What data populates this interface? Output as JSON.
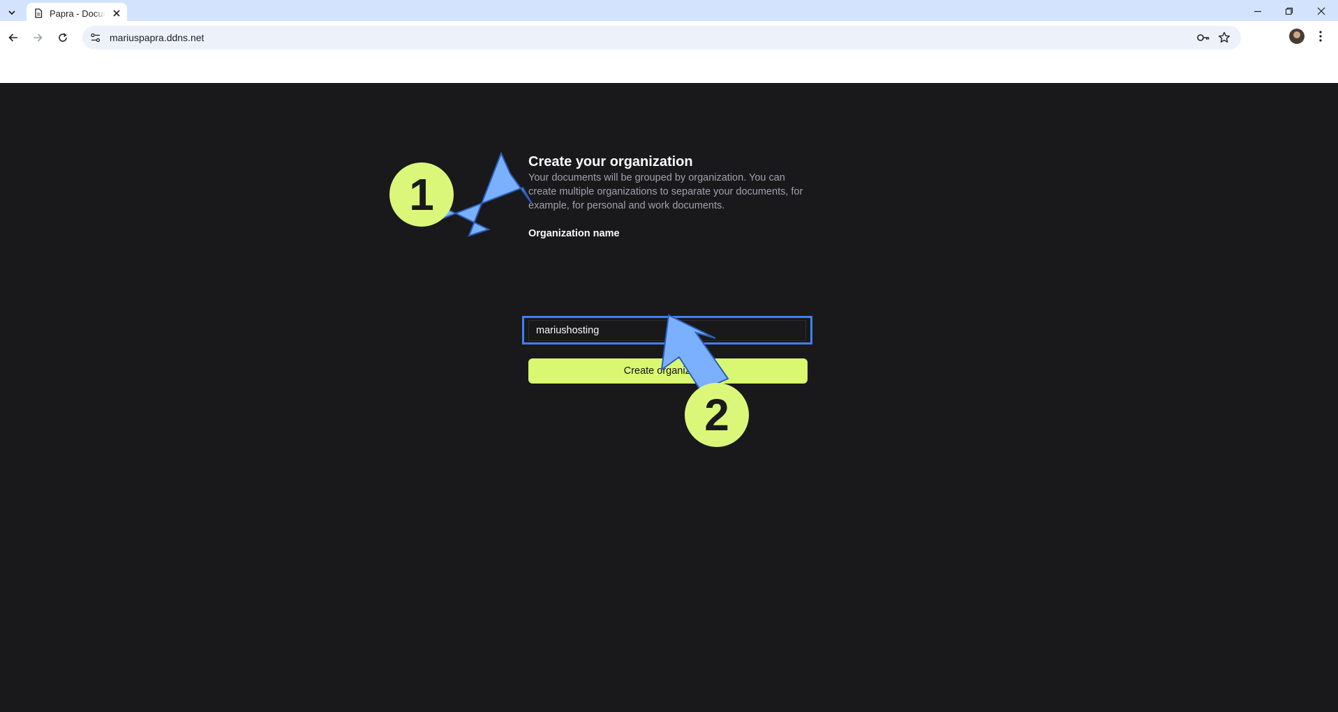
{
  "browser": {
    "tab_title": "Papra - Documents",
    "url": "mariuspapra.ddns.net"
  },
  "form": {
    "heading": "Create your organization",
    "description": "Your documents will be grouped by organization. You can create multiple organizations to separate your documents, for example, for personal and work documents.",
    "field_label": "Organization name",
    "field_value": "mariushosting",
    "submit_label": "Create organization"
  },
  "annotations": {
    "step1": "1",
    "step2": "2"
  },
  "colors": {
    "accent": "#d9f870",
    "annotation_arrow": "#7bb0ff",
    "focus_ring": "#3b82f6",
    "background": "#19191b"
  }
}
